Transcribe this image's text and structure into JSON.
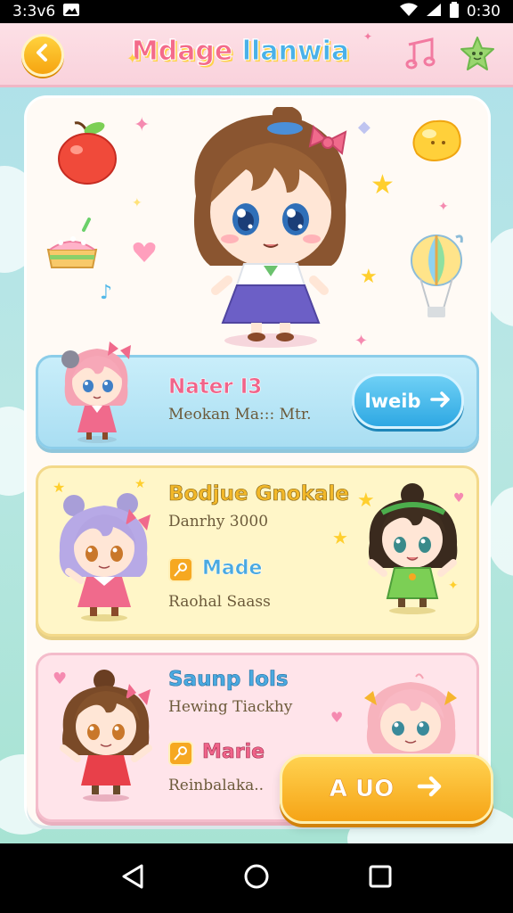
{
  "status_bar": {
    "carrier": "3:3v6",
    "time": "0:30",
    "icons": [
      "gallery-icon",
      "wifi-icon",
      "signal-icon",
      "battery-icon"
    ]
  },
  "header": {
    "title_part1": "Mdage",
    "title_part2": "llanwia",
    "back_icon": "chevron-left-icon",
    "music_icon": "music-note-icon",
    "star_icon": "star-face-icon"
  },
  "entries": [
    {
      "title": "Nater I3",
      "subtitle": "Meokan Ma::: Mtr.",
      "button_label": "lweib",
      "title_color": "#f0648a"
    },
    {
      "title": "Bodjue Gnokale",
      "subtitle": "Danrhy 3000",
      "tag_label": "Made",
      "tag_sub": "Raohal Saass",
      "title_color": "#f2b82a"
    },
    {
      "title": "Saunp lols",
      "subtitle": "Hewing Tiackhy",
      "tag_label": "Marie",
      "tag_sub": "Reinbalaka..",
      "title_color": "#4aa9e0"
    }
  ],
  "action_button": {
    "label": "A UO"
  },
  "colors": {
    "accent_pink": "#f46b8a",
    "accent_blue": "#4ab1e8",
    "accent_yellow": "#f6a416"
  }
}
